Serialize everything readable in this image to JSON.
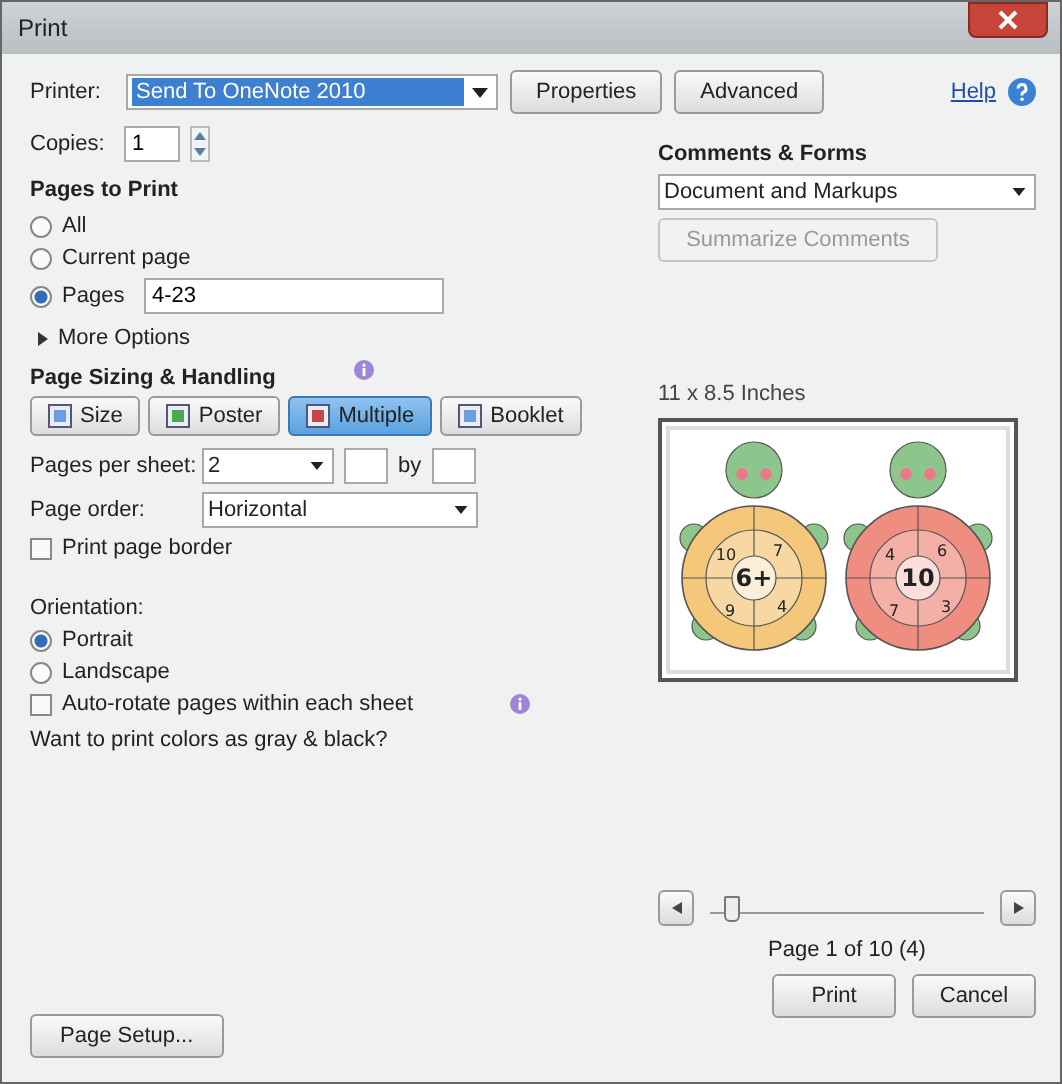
{
  "window": {
    "title": "Print"
  },
  "help": "Help",
  "printer": {
    "label": "Printer:",
    "value": "Send To OneNote 2010"
  },
  "header_buttons": [
    "Properties",
    "Advanced"
  ],
  "copies": {
    "label": "Copies:",
    "value": "1"
  },
  "pages_to_print": {
    "title": "Pages to Print",
    "options": [
      {
        "label": "All",
        "selected": false
      },
      {
        "label": "Current page",
        "selected": false
      },
      {
        "label": "Pages",
        "selected": true
      }
    ],
    "pages_value": "4-23",
    "more_options": "More Options"
  },
  "page_sizing": {
    "title": "Page Sizing & Handling",
    "modes": [
      {
        "label": "Size",
        "selected": false
      },
      {
        "label": "Poster",
        "selected": false
      },
      {
        "label": "Multiple",
        "selected": true
      },
      {
        "label": "Booklet",
        "selected": false
      }
    ],
    "pages_per_sheet": {
      "label": "Pages per sheet:",
      "value": "2",
      "by": "by"
    },
    "page_order": {
      "label": "Page order:",
      "value": "Horizontal"
    },
    "print_page_border": {
      "label": "Print page border",
      "checked": false
    }
  },
  "orientation": {
    "title": "Orientation:",
    "options": [
      {
        "label": "Portrait",
        "selected": true
      },
      {
        "label": "Landscape",
        "selected": false
      }
    ],
    "auto_rotate": {
      "label": "Auto-rotate pages within each sheet",
      "checked": false
    },
    "gray_prompt": "Want to print colors as gray & black?"
  },
  "page_setup_button": "Page Setup...",
  "comments_forms": {
    "title": "Comments & Forms",
    "value": "Document and Markups",
    "summarize_button": {
      "label": "Summarize Comments",
      "disabled": true
    }
  },
  "preview": {
    "size": "11 x 8.5 Inches",
    "turtles": [
      {
        "color": "#f5c77a",
        "center": "6+",
        "numbers": [
          "10",
          "7",
          "9",
          "4"
        ]
      },
      {
        "color": "#ef8d80",
        "center": "10",
        "numbers": [
          "4",
          "6",
          "7",
          "3"
        ]
      }
    ],
    "slider": {
      "level": 0.05
    },
    "page_info": "Page 1 of 10 (4)"
  },
  "footer_buttons": [
    "Print",
    "Cancel"
  ]
}
